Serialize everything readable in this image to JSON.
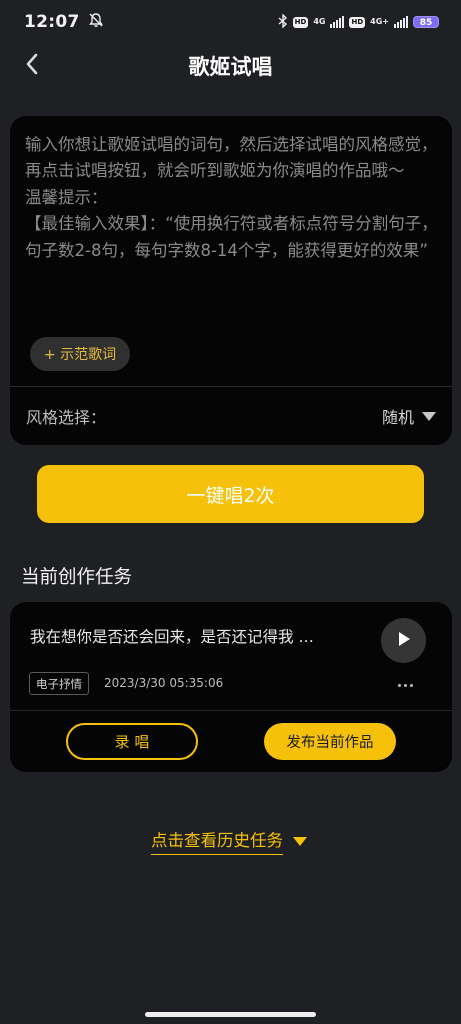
{
  "status_bar": {
    "time": "12:07",
    "network_1": "4G",
    "network_2": "4G+",
    "hd_label": "HD",
    "battery": "85"
  },
  "header": {
    "title": "歌姬试唱"
  },
  "input_card": {
    "placeholder": "输入你想让歌姬试唱的词句，然后选择试唱的风格感觉，再点击试唱按钮，就会听到歌姬为你演唱的作品哦～\n温馨提示：\n【最佳输入效果】：“使用换行符或者标点符号分割句子，句子数2-8句，每句字数8-14个字，能获得更好的效果”",
    "demo_button": "+ 示范歌词",
    "style_label": "风格选择：",
    "style_value": "随机"
  },
  "sing_button": "一键唱2次",
  "current_section_title": "当前创作任务",
  "task": {
    "lyric": "我在想你是否还会回来，是否还记得我 …",
    "tag": "电子抒情",
    "time": "2023/3/30 05:35:06",
    "record_button": "录 唱",
    "publish_button": "发布当前作品"
  },
  "history_link": "点击查看历史任务",
  "colors": {
    "accent": "#f5c10b",
    "background": "#1f2023",
    "card": "#050505"
  },
  "icons": [
    "bell-off-icon",
    "bluetooth-icon",
    "signal-icon",
    "battery-icon",
    "back-arrow-icon",
    "dropdown-triangle-icon",
    "play-icon",
    "more-icon",
    "expand-triangle-icon"
  ]
}
